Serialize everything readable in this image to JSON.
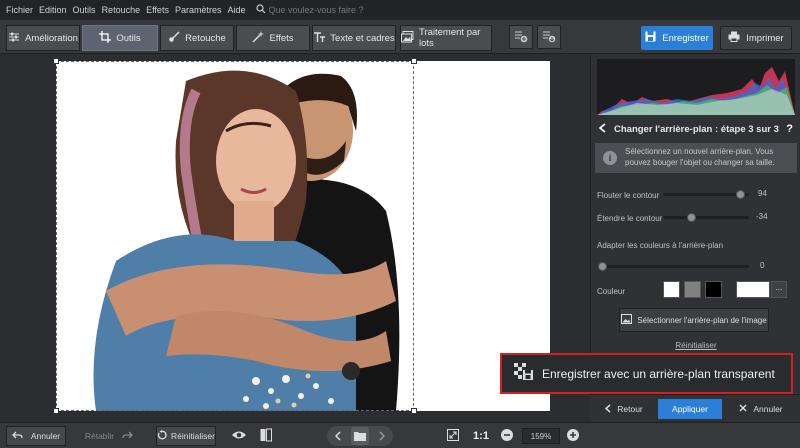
{
  "menu": {
    "items": [
      "Fichier",
      "Edition",
      "Outils",
      "Retouche",
      "Effets",
      "Paramètres",
      "Aide"
    ],
    "search_placeholder": "Que voulez-vous faire ?"
  },
  "toolbar": {
    "tabs": [
      {
        "label": "Amélioration",
        "icon": "sliders-icon"
      },
      {
        "label": "Outils",
        "icon": "crop-icon",
        "active": true
      },
      {
        "label": "Retouche",
        "icon": "brush-icon"
      },
      {
        "label": "Effets",
        "icon": "magic-wand-icon"
      },
      {
        "label": "Texte et cadres",
        "icon": "text-icon"
      },
      {
        "label": "Traitement par lots",
        "icon": "batch-icon"
      }
    ],
    "save_label": "Enregistrer",
    "print_label": "Imprimer"
  },
  "panel": {
    "step_title": "Changer l'arrière-plan : étape 3 sur 3",
    "help_label": "?",
    "info_text": "Sélectionnez un nouvel arrière-plan. Vous pouvez bouger l'objet ou changer sa taille.",
    "sliders": [
      {
        "label": "Flouter le contour",
        "value": "94",
        "fraction": 0.94
      },
      {
        "label": "Étendre le contour",
        "value": "-34",
        "fraction": 0.33
      },
      {
        "label": "Adapter les couleurs à l'arrière-plan",
        "value": "0",
        "fraction": 0.0
      }
    ],
    "couleur_label": "Couleur",
    "swatches": [
      "#ffffff",
      "#808080",
      "#000000",
      "#ffffff"
    ],
    "more_label": "...",
    "select_bg_label": "Sélectionner l'arrière-plan de l'image",
    "reset_link": "Réinitialiser",
    "back_label": "Retour",
    "apply_label": "Appliquer",
    "cancel_label": "Annuler"
  },
  "callout": {
    "text": "Enregistrer avec un arrière-plan transparent"
  },
  "bottom": {
    "undo_label": "Annuler",
    "redo_label": "Rétablir",
    "reset_label": "Réinitialiser",
    "ratio_label": "1:1",
    "zoom": "159%"
  },
  "colors": {
    "accent": "#2b7fd8",
    "callout_border": "#d52020"
  }
}
